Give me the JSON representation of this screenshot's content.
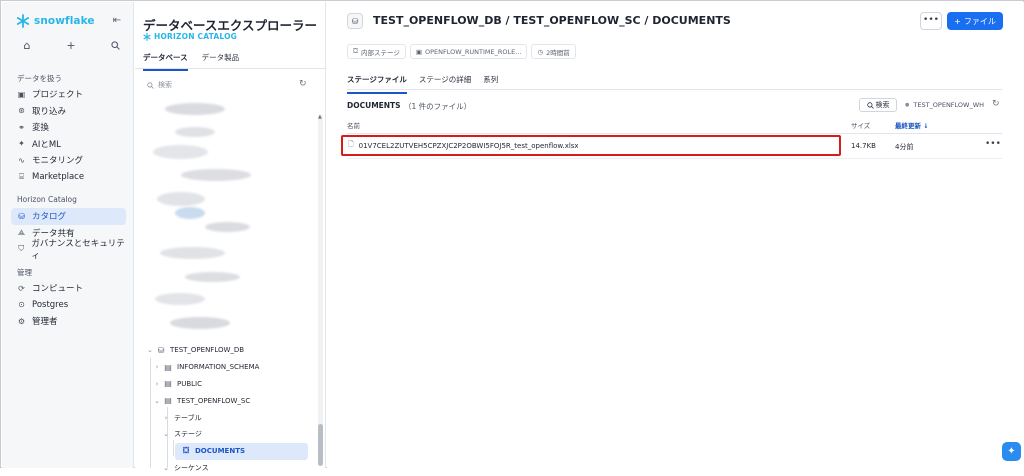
{
  "brand": {
    "name": "snowflake",
    "color": "#29b5e8"
  },
  "sidebar": {
    "section1_label": "データを扱う",
    "items1": [
      {
        "label": "プロジェクト",
        "icon": "project-icon"
      },
      {
        "label": "取り込み",
        "icon": "ingest-icon"
      },
      {
        "label": "変換",
        "icon": "transform-icon"
      },
      {
        "label": "AIとML",
        "icon": "sparkle-icon"
      },
      {
        "label": "モニタリング",
        "icon": "monitor-icon"
      },
      {
        "label": "Marketplace",
        "icon": "marketplace-icon"
      }
    ],
    "section2_label": "Horizon Catalog",
    "items2": [
      {
        "label": "カタログ",
        "icon": "database-icon",
        "active": true
      },
      {
        "label": "データ共有",
        "icon": "share-icon"
      },
      {
        "label": "ガバナンスとセキュリティ",
        "icon": "shield-icon"
      }
    ],
    "section3_label": "管理",
    "items3": [
      {
        "label": "コンピュート",
        "icon": "compute-icon"
      },
      {
        "label": "Postgres",
        "icon": "postgres-icon"
      },
      {
        "label": "管理者",
        "icon": "admin-icon"
      }
    ]
  },
  "explorer": {
    "title": "データベースエクスプローラー",
    "subtitle": "HORIZON CATALOG",
    "tabs": [
      "データベース",
      "データ製品"
    ],
    "search_placeholder": "検索",
    "tree": [
      {
        "label": "TEST_OPENFLOW_DB",
        "level": 0,
        "expanded": true
      },
      {
        "label": "INFORMATION_SCHEMA",
        "level": 1
      },
      {
        "label": "PUBLIC",
        "level": 1
      },
      {
        "label": "TEST_OPENFLOW_SC",
        "level": 1,
        "expanded": true
      },
      {
        "label": "テーブル",
        "level": 2
      },
      {
        "label": "ステージ",
        "level": 2,
        "expanded": true
      },
      {
        "label": "DOCUMENTS",
        "level": 3,
        "selected": true
      },
      {
        "label": "シーケンス",
        "level": 2
      }
    ]
  },
  "main": {
    "breadcrumb": "TEST_OPENFLOW_DB / TEST_OPENFLOW_SC / DOCUMENTS",
    "more_label": "•••",
    "file_button": "ファイル",
    "meta": [
      "内部ステージ",
      "OPENFLOW_RUNTIME_ROLE...",
      "2時間前"
    ],
    "tabs": [
      "ステージファイル",
      "ステージの詳細",
      "系列"
    ],
    "docs_title": "DOCUMENTS",
    "docs_count": "（1 件のファイル）",
    "search_button": "検索",
    "warehouse": "TEST_OPENFLOW_WH",
    "columns": {
      "name": "名前",
      "size": "サイズ",
      "updated": "最終更新"
    },
    "files": [
      {
        "name": "01V7CEL2ZUTVEH5CPZXJC2P2OBWI5FOJ5R_test_openflow.xlsx",
        "size": "14.7KB",
        "updated": "4分前"
      }
    ],
    "highlight_color": "#d81b1b",
    "accent_color": "#1a6ef2"
  }
}
